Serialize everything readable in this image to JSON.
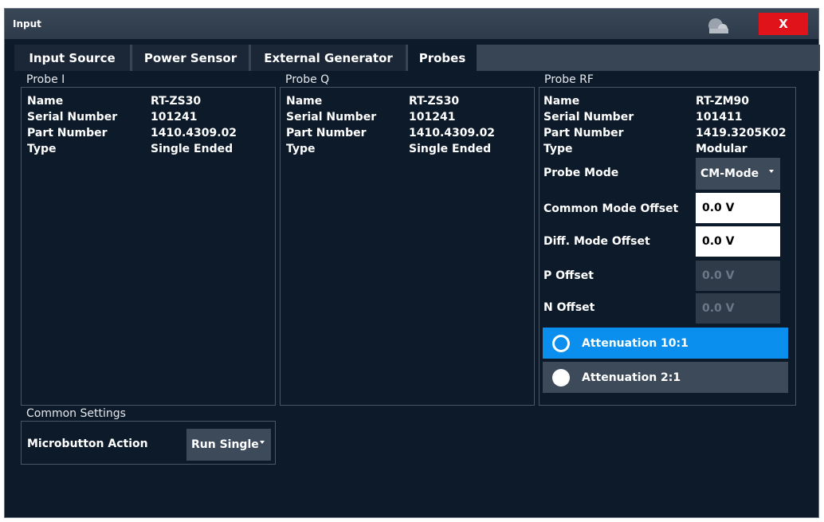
{
  "window": {
    "title": "Input",
    "close_label": "X"
  },
  "tabs": [
    {
      "label": "Input Source",
      "active": false
    },
    {
      "label": "Power Sensor",
      "active": false
    },
    {
      "label": "External Generator",
      "active": false
    },
    {
      "label": "Probes",
      "active": true
    }
  ],
  "probe_i": {
    "group_label": "Probe I",
    "rows": [
      {
        "label": "Name",
        "value": "RT-ZS30"
      },
      {
        "label": "Serial Number",
        "value": "101241"
      },
      {
        "label": "Part Number",
        "value": "1410.4309.02"
      },
      {
        "label": "Type",
        "value": "Single Ended"
      }
    ]
  },
  "probe_q": {
    "group_label": "Probe Q",
    "rows": [
      {
        "label": "Name",
        "value": "RT-ZS30"
      },
      {
        "label": "Serial Number",
        "value": "101241"
      },
      {
        "label": "Part Number",
        "value": "1410.4309.02"
      },
      {
        "label": "Type",
        "value": "Single Ended"
      }
    ]
  },
  "probe_rf": {
    "group_label": "Probe RF",
    "rows": [
      {
        "label": "Name",
        "value": "RT-ZM90"
      },
      {
        "label": "Serial Number",
        "value": "101411"
      },
      {
        "label": "Part Number",
        "value": "1419.3205K02"
      },
      {
        "label": "Type",
        "value": "Modular"
      }
    ],
    "probe_mode": {
      "label": "Probe Mode",
      "value": "CM-Mode"
    },
    "common_mode_offset": {
      "label": "Common Mode Offset",
      "value": "0.0 V"
    },
    "diff_mode_offset": {
      "label": "Diff. Mode Offset",
      "value": "0.0 V"
    },
    "p_offset": {
      "label": "P Offset",
      "value": "0.0 V",
      "enabled": false
    },
    "n_offset": {
      "label": "N Offset",
      "value": "0.0 V",
      "enabled": false
    },
    "attenuation": [
      {
        "label": "Attenuation 10:1",
        "selected": true
      },
      {
        "label": "Attenuation 2:1",
        "selected": false
      }
    ]
  },
  "common_settings": {
    "group_label": "Common Settings",
    "microbutton_label": "Microbutton Action",
    "microbutton_value": "Run Single"
  },
  "colors": {
    "background": "#0d1a2a",
    "accent_selected": "#0a8fee",
    "close_red": "#e0131a"
  }
}
